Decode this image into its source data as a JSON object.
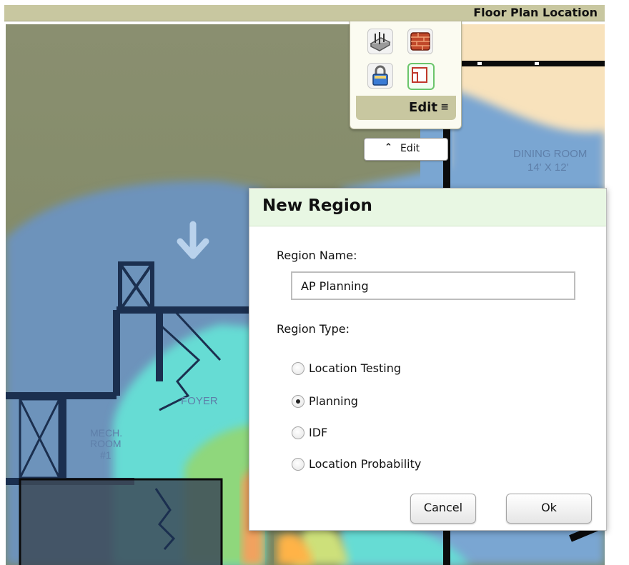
{
  "header": {
    "title": "Floor Plan Location"
  },
  "toolbox": {
    "edit_label": "Edit",
    "tools": [
      "router-tool-icon",
      "wall-tool-icon",
      "lock-tool-icon",
      "region-tool-icon"
    ]
  },
  "edit_toggle": {
    "label": "Edit"
  },
  "floorplan": {
    "room_dining": "DINING ROOM",
    "room_dining_size": "14' X 12'",
    "room_foyer": "FOYER",
    "room_mech_1": "MECH.",
    "room_mech_2": "ROOM",
    "room_mech_3": "#1"
  },
  "dialog": {
    "title": "New Region",
    "name_label": "Region Name:",
    "name_value": "AP Planning",
    "type_label": "Region Type:",
    "options": [
      {
        "label": "Location Testing",
        "selected": false
      },
      {
        "label": "Planning",
        "selected": true
      },
      {
        "label": "IDF",
        "selected": false
      },
      {
        "label": "Location Probability",
        "selected": false
      }
    ],
    "cancel_label": "Cancel",
    "ok_label": "Ok"
  }
}
